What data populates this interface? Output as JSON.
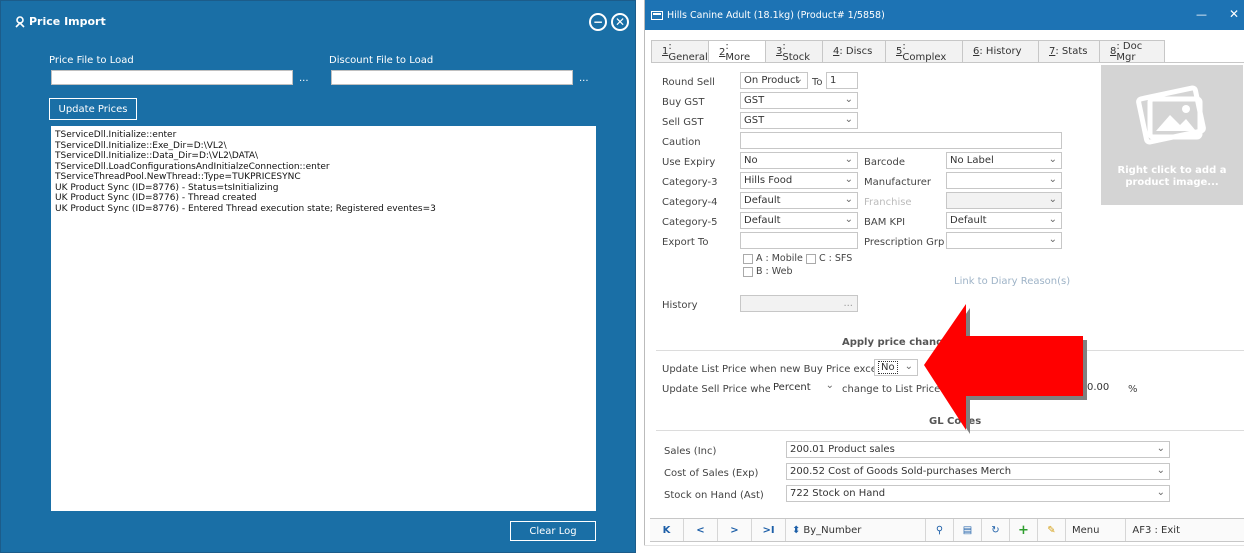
{
  "price_import": {
    "title": "Price Import",
    "price_file_label": "Price File to Load",
    "discount_file_label": "Discount File to Load",
    "price_file_value": "",
    "discount_file_value": "",
    "browse_label": "...",
    "update_button": "Update Prices",
    "clear_log_button": "Clear Log",
    "log_lines": [
      "TServiceDll.Initialize::enter",
      "TServiceDll.Initialize::Exe_Dir=D:\\VL2\\",
      "TServiceDll.Initialize::Data_Dir=D:\\VL2\\DATA\\",
      "TServiceDll.LoadConfigurationsAndInitialzeConnection::enter",
      "TServiceThreadPool.NewThread::Type=TUKPRICESYNC",
      "UK Product Sync (ID=8776) - Status=tsInitializing",
      "UK Product Sync (ID=8776) - Thread created",
      "UK Product Sync (ID=8776) - Entered Thread execution state; Registered eventes=3"
    ]
  },
  "product": {
    "title": "Hills Canine Adult (18.1kg) (Product# 1/5858)",
    "tabs": [
      {
        "key": "1",
        "label": ": General"
      },
      {
        "key": "2",
        "label": ": More"
      },
      {
        "key": "3",
        "label": ": Stock"
      },
      {
        "key": "4",
        "label": ": Discs"
      },
      {
        "key": "5",
        "label": ": Complex"
      },
      {
        "key": "6",
        "label": ": History"
      },
      {
        "key": "7",
        "label": ": Stats"
      },
      {
        "key": "8",
        "label": ": Doc Mgr"
      }
    ],
    "fields": {
      "round_sell_label": "Round Sell",
      "round_sell_value": "On Product",
      "to_label": "To",
      "to_value": "1",
      "buy_gst_label": "Buy GST",
      "buy_gst_value": "GST",
      "sell_gst_label": "Sell GST",
      "sell_gst_value": "GST",
      "caution_label": "Caution",
      "caution_value": "",
      "use_expiry_label": "Use Expiry",
      "use_expiry_value": "No",
      "barcode_label": "Barcode",
      "barcode_value": "No Label",
      "category3_label": "Category-3",
      "category3_value": "Hills Food",
      "manufacturer_label": "Manufacturer",
      "manufacturer_value": "",
      "category4_label": "Category-4",
      "category4_value": "Default",
      "franchise_label": "Franchise",
      "franchise_value": "",
      "category5_label": "Category-5",
      "category5_value": "Default",
      "bam_kpi_label": "BAM KPI",
      "bam_kpi_value": "Default",
      "export_to_label": "Export To",
      "export_to_value": "",
      "prescription_grp_label": "Prescription Grp",
      "prescription_grp_value": "",
      "export_a": "A : Mobile",
      "export_c": "C : SFS",
      "export_b": "B : Web",
      "link_diary": "Link to Diary Reason(s)",
      "history_label": "History",
      "history_value": "..."
    },
    "image_hint": "Right click to add a product image...",
    "apply_price_header": "Apply price changes",
    "update_list_label": "Update List Price when new Buy Price exceeds",
    "update_list_value": "No",
    "update_sell_label": "Update Sell Price when",
    "update_sell_value": "Percent",
    "change_to_label": "change to List Price e",
    "percent_value": "0.00",
    "percent_sign": "%",
    "gl_header": "GL Codes",
    "gl_header_visible": "GL Co",
    "gl_header_tail": "s",
    "sales_label": "Sales  (Inc)",
    "sales_value": "200.01 Product sales",
    "cos_label": "Cost of Sales  (Exp)",
    "cos_value": "200.52 Cost of Goods Sold-purchases Merch",
    "soh_label": "Stock on Hand  (Ast)",
    "soh_value": "722 Stock on Hand",
    "nav": {
      "first": "K",
      "prev": "<",
      "next": ">",
      "last": ">I",
      "sort": "By_Number",
      "menu": "Menu",
      "exit": "AF3 : Exit"
    }
  },
  "colors": {
    "left_bg": "#1a6fa6",
    "title_bar": "#1d73b4",
    "arrow": "#ff0000"
  }
}
